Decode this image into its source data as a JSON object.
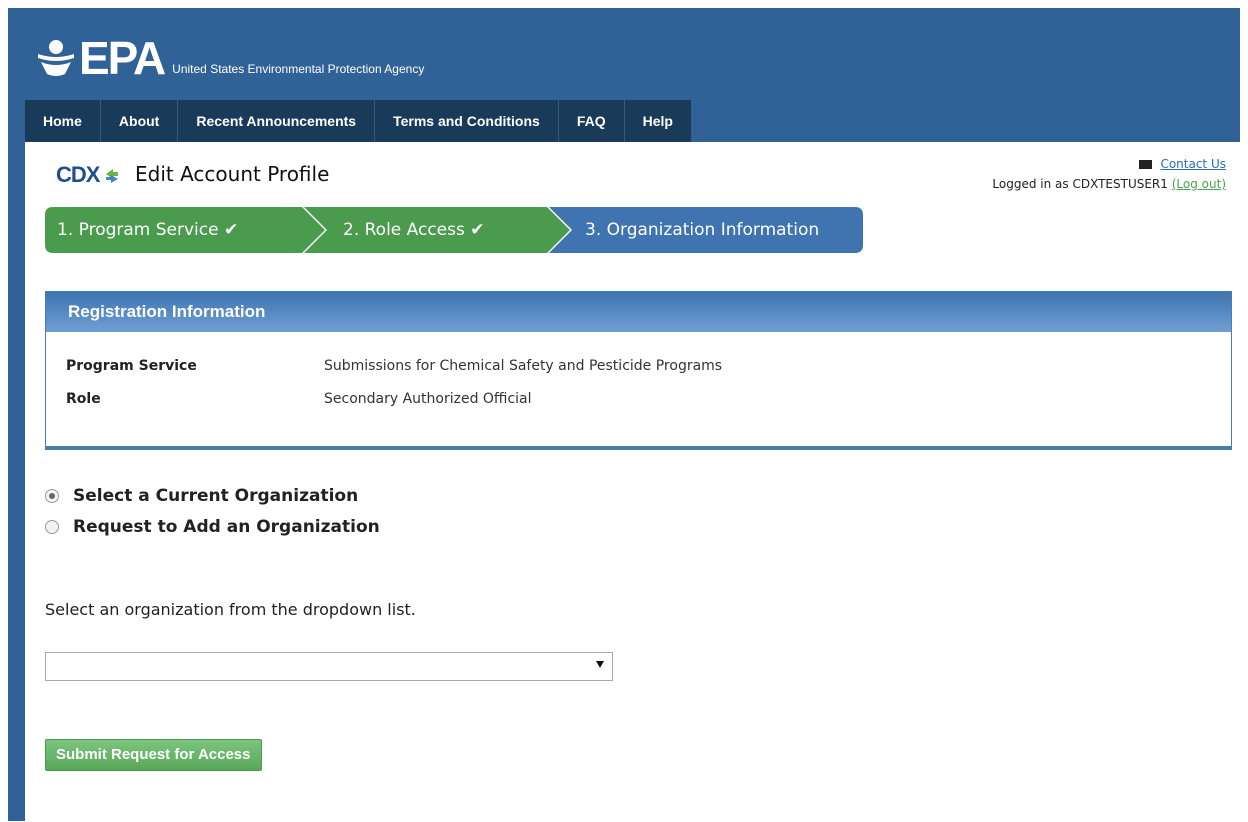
{
  "header": {
    "logo_text": "EPA",
    "agency_name": "United States Environmental Protection Agency"
  },
  "nav": {
    "items": [
      "Home",
      "About",
      "Recent Announcements",
      "Terms and Conditions",
      "FAQ",
      "Help"
    ]
  },
  "page": {
    "cdx_logo": "CDX",
    "title": "Edit Account Profile"
  },
  "user_box": {
    "contact_label": "Contact Us",
    "logged_in_text": "Logged in as CDXTESTUSER1",
    "logout_label": "(Log out)"
  },
  "steps": [
    {
      "label": "1. Program Service",
      "status": "complete"
    },
    {
      "label": "2. Role Access",
      "status": "complete"
    },
    {
      "label": "3. Organization Information",
      "status": "current"
    }
  ],
  "registration": {
    "header": "Registration Information",
    "rows": [
      {
        "key": "Program Service",
        "value": "Submissions for Chemical Safety and Pesticide Programs"
      },
      {
        "key": "Role",
        "value": "Secondary Authorized Official"
      }
    ]
  },
  "org_options": [
    {
      "label": "Select a Current Organization",
      "selected": true
    },
    {
      "label": "Request to Add an Organization",
      "selected": false
    }
  ],
  "instruction": "Select an organization from the dropdown list.",
  "org_select": {
    "value": ""
  },
  "submit_label": "Submit Request for Access",
  "colors": {
    "brand_blue": "#316297",
    "nav_dark": "#1a3a5a",
    "step_green": "#4a9b4d",
    "step_current_blue": "#3f74b0",
    "button_green": "#5aa85c"
  }
}
